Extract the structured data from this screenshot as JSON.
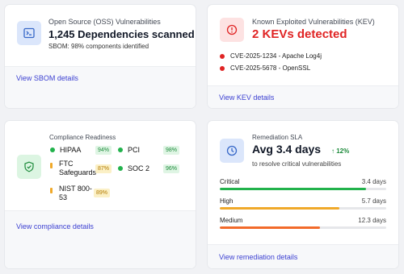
{
  "oss": {
    "label": "Open Source (OSS) Vulnerabilities",
    "headline": "1,245 Dependencies scanned",
    "sub": "SBOM: 98% components identified",
    "link": "View SBOM details",
    "icon": "terminal-icon"
  },
  "kev": {
    "label": "Known Exploited Vulnerabilities (KEV)",
    "headline": "2 KEVs detected",
    "items": [
      {
        "text": "CVE-2025-1234 - Apache Log4j"
      },
      {
        "text": "CVE-2025-5678 - OpenSSL"
      }
    ],
    "link": "View KEV details",
    "accent": "#e02424",
    "icon": "alert-circle-icon"
  },
  "compliance": {
    "label": "Compliance Readiness",
    "items": [
      {
        "name": "HIPAA",
        "value": "94%",
        "status": "ok"
      },
      {
        "name": "PCI",
        "value": "98%",
        "status": "ok"
      },
      {
        "name": "FTC Safeguards",
        "value": "87%",
        "status": "warn"
      },
      {
        "name": "SOC 2",
        "value": "96%",
        "status": "ok"
      },
      {
        "name": "NIST 800-53",
        "value": "89%",
        "status": "warn"
      }
    ],
    "link": "View compliance details",
    "icon": "shield-check-icon"
  },
  "sla": {
    "label": "Remediation SLA",
    "headline": "Avg 3.4 days",
    "trend": "↑ 12%",
    "sub": "to resolve critical vulnerabilities",
    "rows": [
      {
        "name": "Critical",
        "value": "3.4 days",
        "fill": 0.88,
        "color": "#22b24c"
      },
      {
        "name": "High",
        "value": "5.7 days",
        "fill": 0.72,
        "color": "#f0a92a"
      },
      {
        "name": "Medium",
        "value": "12.3 days",
        "fill": 0.6,
        "color": "#f26a2a"
      }
    ],
    "link": "View remediation details",
    "icon": "clock-icon"
  },
  "colors": {
    "ok_dot": "#22b24c",
    "warn_dot": "#f0a92a",
    "link": "#3b3fd1"
  }
}
